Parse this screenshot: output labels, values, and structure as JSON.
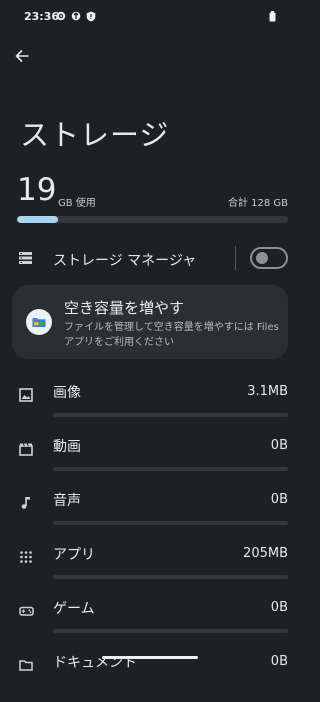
{
  "status_bar": {
    "time": "23:36",
    "icons": [
      "gear-icon",
      "vpn-icon",
      "shield-icon"
    ],
    "battery_icon": "battery-icon"
  },
  "header": {
    "back_icon": "back-arrow-icon",
    "title": "ストレージ"
  },
  "usage": {
    "used_value": "19",
    "used_unit": "GB 使用",
    "total": "合計 128 GB",
    "used_fraction": 0.15,
    "accent_color": "#a8d4f0"
  },
  "storage_manager": {
    "label": "ストレージ マネージャ",
    "enabled": false
  },
  "free_up_card": {
    "title": "空き容量を増やす",
    "description": "ファイルを管理して空き容量を増やすには Files アプリをご利用ください",
    "icon": "files-app-icon"
  },
  "categories": [
    {
      "label": "画像",
      "size": "3.1MB",
      "icon": "image-icon",
      "fraction": 0.0
    },
    {
      "label": "動画",
      "size": "0B",
      "icon": "video-icon",
      "fraction": 0.0
    },
    {
      "label": "音声",
      "size": "0B",
      "icon": "music-note-icon",
      "fraction": 0.0
    },
    {
      "label": "アプリ",
      "size": "205MB",
      "icon": "apps-grid-icon",
      "fraction": 0.0
    },
    {
      "label": "ゲーム",
      "size": "0B",
      "icon": "gamepad-icon",
      "fraction": 0.0
    },
    {
      "label": "ドキュメント",
      "size": "0B",
      "icon": "folder-icon",
      "fraction": 0.0
    }
  ]
}
